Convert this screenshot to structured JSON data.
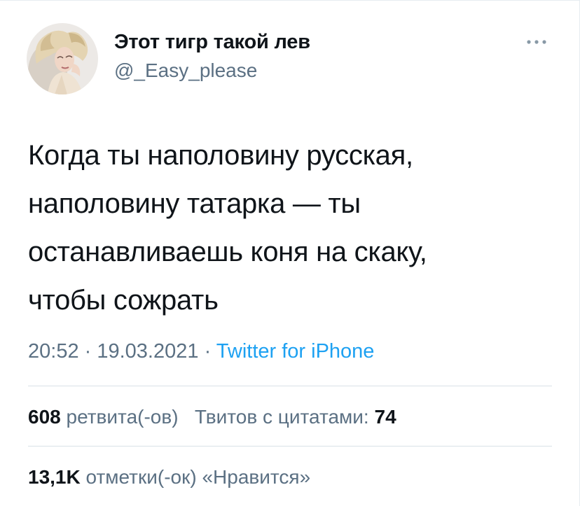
{
  "user": {
    "display_name": "Этот тигр такой лев",
    "handle": "@_Easy_please",
    "avatar_icon": "user-avatar-photo"
  },
  "more_icon": "more-horizontal-icon",
  "tweet": {
    "lines": [
      "Когда ты наполовину русская,",
      "наполовину татарка — ты",
      "останавливаешь коня на скаку,",
      "чтобы сожрать"
    ],
    "time": "20:52",
    "sep1": " · ",
    "date": "19.03.2021",
    "sep2": " · ",
    "source": "Twitter for iPhone"
  },
  "stats": {
    "retweets_count": "608",
    "retweets_label": "ретвита(-ов)",
    "quotes_label": "Твитов с цитатами:",
    "quotes_count": "74",
    "likes_count": "13,1K",
    "likes_label": "отметки(-ок) «Нравится»"
  },
  "colors": {
    "text": "#0f1419",
    "secondary": "#5b7083",
    "link": "#1da1f2",
    "divider": "#d9e1e7"
  }
}
